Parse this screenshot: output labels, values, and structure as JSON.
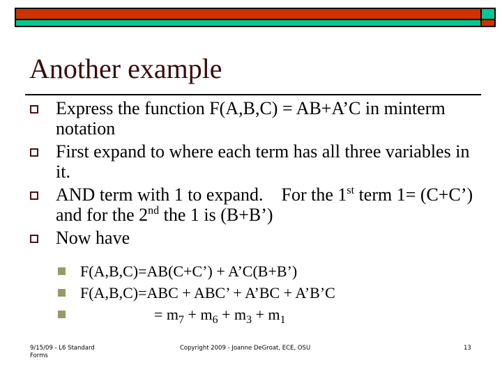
{
  "slide": {
    "title": "Another example",
    "bullets": [
      {
        "text": "Express the function F(A,B,C) = AB+A’C in minterm notation"
      },
      {
        "text": "First expand to where each term has all three variables in it."
      },
      {
        "parts": {
          "a": "AND term with 1 to expand.    For the 1",
          "a_sup": "st",
          "b": " term 1= (C+C’) and for the 2",
          "b_sup": "nd",
          "c": " the 1 is (B+B’)"
        }
      },
      {
        "text": "Now have"
      }
    ],
    "sub_bullets": [
      {
        "text": "F(A,B,C)=AB(C+C’) + A’C(B+B’)"
      },
      {
        "text": "F(A,B,C)=ABC + ABC’ + A’BC + A’B’C"
      },
      {
        "minterms": {
          "prefix": "= m",
          "s1": "7",
          "j1": " + m",
          "s2": "6",
          "j2": " + m",
          "s3": "3",
          "j3": " + m",
          "s4": "1"
        }
      }
    ],
    "colors": {
      "bar_red": "#cc3300",
      "bar_teal": "#00c896",
      "title": "#3b0a0a",
      "bullet_box": "#4a1010",
      "sub_bullet": "#999966"
    }
  },
  "footer": {
    "left": "9/15/09 - L6 Standard Forms",
    "center": "Copyright 2009 - Joanne DeGroat, ECE, OSU",
    "page_number": "13"
  }
}
